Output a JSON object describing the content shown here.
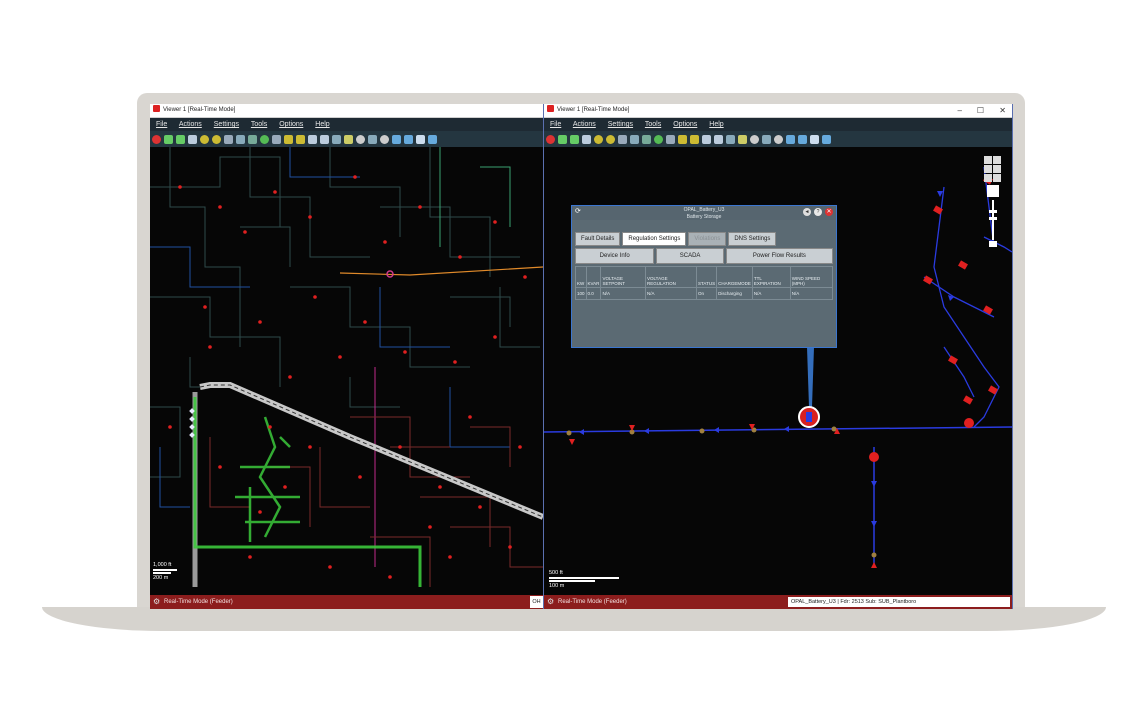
{
  "left_window": {
    "title": "Viewer 1 [Real-Time Mode]",
    "menu": [
      "File",
      "Actions",
      "Settings",
      "Tools",
      "Options",
      "Help"
    ],
    "scale_top": "1,000 ft",
    "scale_bottom": "200 m",
    "status": "Real-Time Mode (Feeder)",
    "status_chip": "OH"
  },
  "right_window": {
    "title": "Viewer 1 [Real-Time Mode]",
    "menu": [
      "File",
      "Actions",
      "Settings",
      "Tools",
      "Options",
      "Help"
    ],
    "window_controls": [
      "–",
      "☐",
      "✕"
    ],
    "scale_top": "500 ft",
    "scale_bottom": "100 m",
    "status": "Real-Time Mode (Feeder)",
    "status_field": "OPAL_Battery_U3 | Fdr: 2513 Sub: SUB_Plantboro"
  },
  "popup": {
    "title": "OPAL_Battery_U3",
    "subtitle": "Battery Storage",
    "tabs": [
      {
        "label": "Fault Details",
        "state": "normal"
      },
      {
        "label": "Regulation Settings",
        "state": "active"
      },
      {
        "label": "Violations",
        "state": "disabled"
      },
      {
        "label": "DNS Settings",
        "state": "normal"
      }
    ],
    "subtabs": [
      "Device Info",
      "SCADA",
      "Power Flow Results"
    ],
    "columns": [
      "KW",
      "KVAR",
      "VOLTAGE SETPOINT",
      "VOLTAGE REGULATION",
      "STATUS",
      "CHARGEMODE",
      "TTL EXPIRATION",
      "WIND SPEED (MPH)"
    ],
    "row": [
      "100",
      "0.0",
      "N/A",
      "N/A",
      "On",
      "Discharging",
      "N/A",
      "N/A"
    ]
  },
  "colors": {
    "status_bar": "#8c1d1d",
    "menubar": "#1e2a33",
    "feeder_line": "#2a3be0",
    "highlight": "#3cc83c",
    "device": "#e02020"
  }
}
